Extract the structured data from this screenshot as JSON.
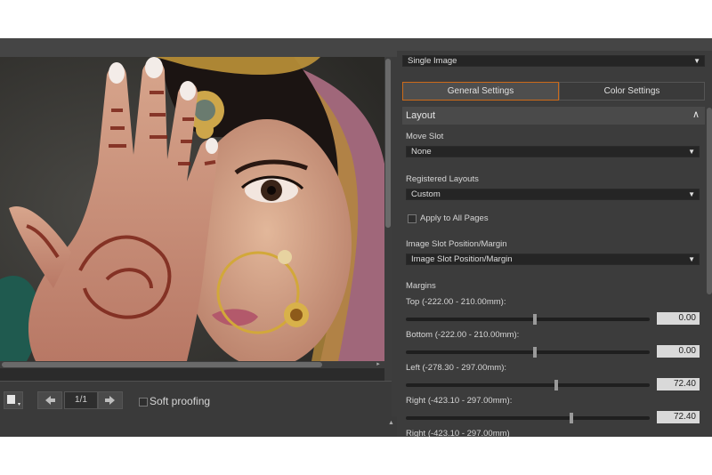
{
  "preview": {
    "page_counter": "1/1",
    "soft_proofing_label": "Soft proofing"
  },
  "panel": {
    "layout_dropdown_value": "Single Image",
    "tabs": [
      "General Settings",
      "Color Settings"
    ],
    "section_title": "Layout",
    "move_slot": {
      "label": "Move Slot",
      "value": "None"
    },
    "registered_layouts": {
      "label": "Registered Layouts",
      "value": "Custom"
    },
    "apply_all_label": "Apply to All Pages",
    "slot_position": {
      "label": "Image Slot Position/Margin",
      "value": "Image Slot Position/Margin"
    },
    "margins_label": "Margins",
    "margins": [
      {
        "label": "Top (-222.00 - 210.00mm):",
        "value": "0.00",
        "position": 0.53
      },
      {
        "label": "Bottom (-222.00 - 210.00mm):",
        "value": "0.00",
        "position": 0.53
      },
      {
        "label": "Left (-278.30 - 297.00mm):",
        "value": "72.40",
        "position": 0.62
      },
      {
        "label": "Right (-423.10 - 297.00mm):",
        "value": "72.40",
        "position": 0.68
      }
    ],
    "cut_off_label": "Right (-423.10 - 297.00mm)"
  },
  "colors": {
    "panel_bg": "#3c3c3c",
    "dropdown_bg": "#252525",
    "value_field_bg": "#d9d9d9",
    "tab_active_border": "#cc6a1a"
  }
}
